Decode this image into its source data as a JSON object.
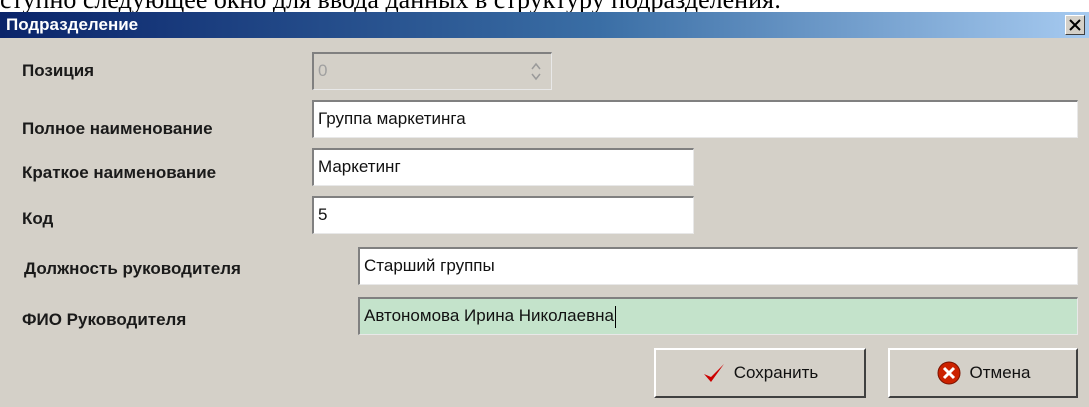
{
  "window": {
    "title": "Подразделение",
    "close_glyph": "×",
    "close_icon": "close-icon"
  },
  "form": {
    "position": {
      "label": "Позиция",
      "value": "0"
    },
    "full_name": {
      "label": "Полное наименование",
      "value": "Группа маркетинга"
    },
    "short_name": {
      "label": "Краткое наименование",
      "value": "Маркетинг"
    },
    "code": {
      "label": "Код",
      "value": "5"
    },
    "head_position": {
      "label": "Должность руководителя",
      "value": "Старший группы"
    },
    "head_name": {
      "label": "ФИО Руководителя",
      "value": "Автономова Ирина Николаевна"
    }
  },
  "buttons": {
    "save": {
      "label": "Сохранить",
      "icon": "checkmark-icon",
      "icon_color": "#cc0000"
    },
    "cancel": {
      "label": "Отмена",
      "icon": "cancel-icon",
      "icon_color": "#cc2200"
    }
  },
  "colors": {
    "active_field_bg": "#c4e3cb",
    "titlebar_start": "#0a246a",
    "titlebar_end": "#a6caf0",
    "dialog_bg": "#d4d0c8"
  }
}
